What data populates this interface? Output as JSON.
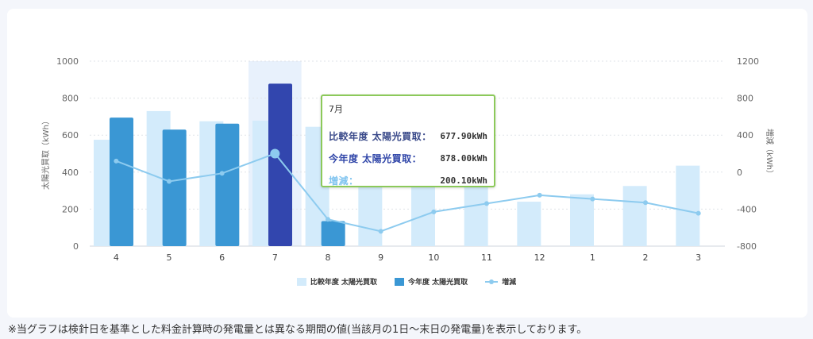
{
  "chart_data": {
    "type": "bar",
    "categories": [
      "4",
      "5",
      "6",
      "7",
      "8",
      "9",
      "10",
      "11",
      "12",
      "1",
      "2",
      "3"
    ],
    "y_left": {
      "label": "太陽光買取（kWh）",
      "range": [
        0,
        1000
      ],
      "ticks": [
        "0",
        "200",
        "400",
        "600",
        "800",
        "1000"
      ]
    },
    "y_right": {
      "label": "増減（kWh）",
      "range": [
        -800,
        1200
      ],
      "ticks": [
        "-800",
        "-400",
        "0",
        "400",
        "800",
        "1200"
      ]
    },
    "series": [
      {
        "name": "比較年度 太陽光買取",
        "type": "bar",
        "color": "#d3ebfb",
        "axis": "left",
        "values": [
          575,
          730,
          675,
          677.9,
          645,
          420,
          445,
          400,
          240,
          280,
          325,
          435
        ]
      },
      {
        "name": "今年度 太陽光買取",
        "type": "bar",
        "color": "#3a97d4",
        "axis": "left",
        "values": [
          695,
          630,
          662,
          878.0,
          135,
          null,
          null,
          null,
          null,
          null,
          null,
          null
        ]
      },
      {
        "name": "増減",
        "type": "line",
        "color": "#8dcbef",
        "axis": "right",
        "values": [
          120,
          -100,
          -13,
          200.1,
          -510,
          -640,
          -430,
          -340,
          -250,
          -290,
          -330,
          -445
        ]
      }
    ],
    "highlight_category": "7",
    "highlight_color": "#3246ae",
    "grid": true,
    "legend_position": "bottom"
  },
  "tooltip": {
    "title": "7月",
    "rows": [
      {
        "label": "比較年度 太陽光買取：",
        "value": "677.90kWh"
      },
      {
        "label": "今年度 太陽光買取：",
        "value": "878.00kWh"
      },
      {
        "label": "増減：",
        "value": "200.10kWh"
      }
    ]
  },
  "footnote": "※当グラフは検針日を基準とした料金計算時の発電量とは異なる期間の値(当該月の1日～末日の発電量)を表示しております。"
}
